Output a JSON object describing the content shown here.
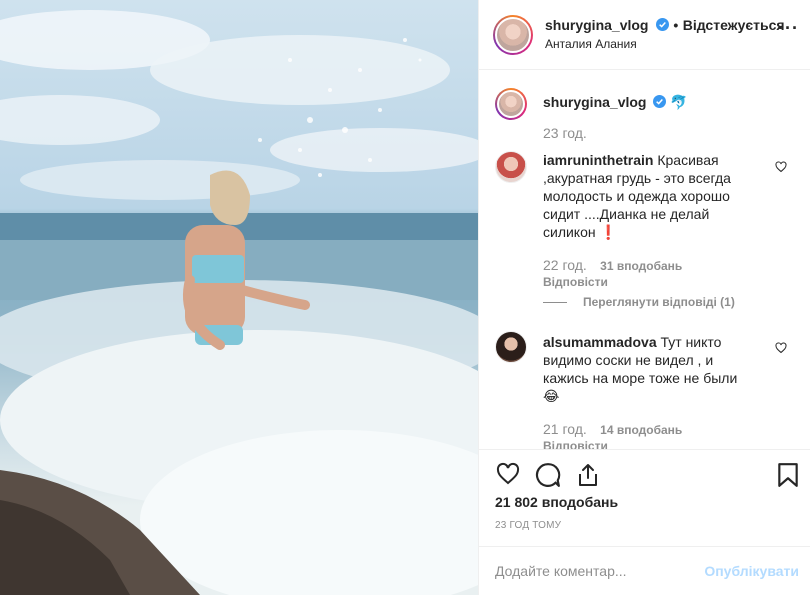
{
  "post": {
    "username": "shurygina_vlog",
    "follow_label": "Відстежується",
    "separator": "•",
    "location": "Анталия Алания",
    "more_icon": "more-dots-icon"
  },
  "caption": {
    "username": "shurygina_vlog",
    "emoji": "🐬",
    "time": "23 год."
  },
  "comments": [
    {
      "username": "iamruninthetrain",
      "text": "Красивая ,акуратная грудь - это всегда молодость и одежда хорошо сидит ....Дианка не делай силикон ❗",
      "time": "22 год.",
      "likes": "31 вподобань",
      "reply": "Відповісти",
      "view_replies": "Переглянути відповіді (1)"
    },
    {
      "username": "alsumammadova",
      "text": "Тут никто видимо соски не видел , и кажись на море тоже не были 😂",
      "time": "21 год.",
      "likes": "14 вподобань",
      "reply": "Відповісти"
    }
  ],
  "footer": {
    "likes_count": "21 802 вподобань",
    "time_ago": "23 ГОД ТОМУ",
    "comment_placeholder": "Додайте коментар...",
    "publish_label": "Опублікувати"
  },
  "colors": {
    "verified": "#3897f0",
    "muted": "#8e8e8e",
    "publish_disabled": "#b3dbff"
  }
}
